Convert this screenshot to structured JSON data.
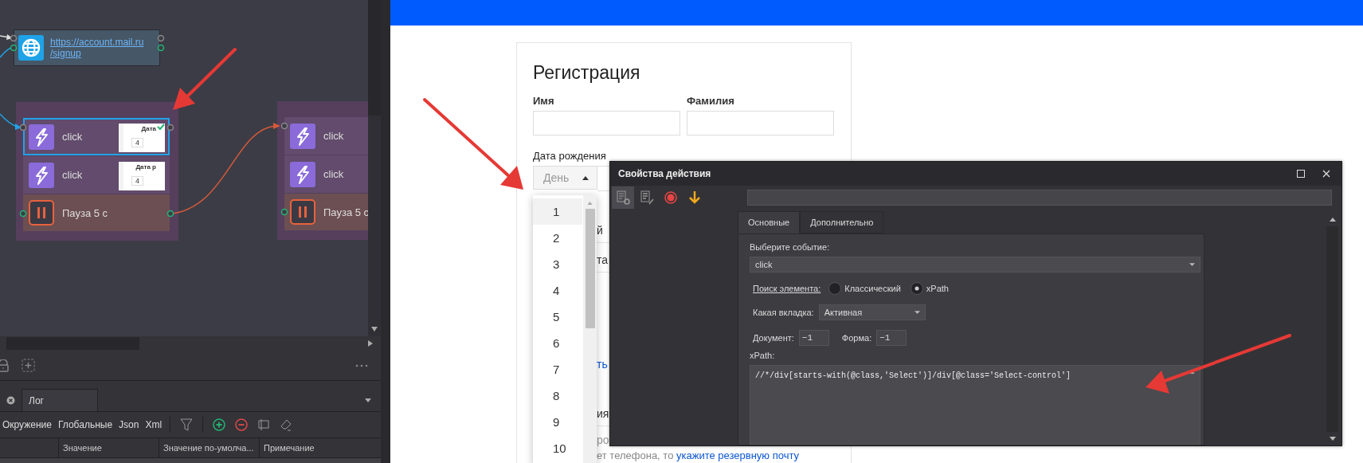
{
  "canvas": {
    "url_node": {
      "url_lines": [
        "https://account.mail.ru",
        "/signup"
      ]
    },
    "groups": [
      {
        "rows": [
          {
            "kind": "action",
            "label": "click",
            "selected": true,
            "thumbnail": {
              "label": "Дата",
              "value": "4",
              "checked": true
            }
          },
          {
            "kind": "action",
            "label": "click",
            "selected": false,
            "thumbnail": {
              "label": "Дата р",
              "value": "4",
              "checked": false
            }
          },
          {
            "kind": "pause",
            "label": "Пауза 5 с",
            "selected": false
          }
        ]
      },
      {
        "rows": [
          {
            "kind": "action",
            "label": "click",
            "selected": false
          },
          {
            "kind": "action",
            "label": "click",
            "selected": false
          },
          {
            "kind": "pause",
            "label": "Пауза 5 с",
            "selected": false
          }
        ]
      }
    ]
  },
  "bottom_panel": {
    "tabs": [
      {
        "label": "Лог",
        "selected": true
      }
    ],
    "toolbar": [
      "Окружение",
      "Глобальные",
      "Json",
      "Xml"
    ],
    "columns": [
      "Значение",
      "Значение по-умолча...",
      "Примечание"
    ]
  },
  "page": {
    "title": "Регистрация",
    "fields": [
      {
        "label": "Имя"
      },
      {
        "label": "Фамилия"
      }
    ],
    "birth_date": {
      "label": "Дата рождения",
      "day_select": {
        "placeholder": "День",
        "expanded": true
      }
    },
    "day_options": [
      {
        "label": "1",
        "selected": true
      },
      {
        "label": "2",
        "selected": false
      },
      {
        "label": "3",
        "selected": false
      },
      {
        "label": "4",
        "selected": false
      },
      {
        "label": "5",
        "selected": false
      },
      {
        "label": "6",
        "selected": false
      },
      {
        "label": "7",
        "selected": false
      },
      {
        "label": "8",
        "selected": false
      },
      {
        "label": "9",
        "selected": false
      },
      {
        "label": "10",
        "selected": false
      }
    ],
    "fragments": [
      {
        "text": "й",
        "kind": "text"
      },
      {
        "text": "та",
        "kind": "text"
      },
      {
        "text": "ть",
        "kind": "link"
      },
      {
        "text": "ия",
        "kind": "text"
      },
      {
        "text": "ро",
        "kind": "text"
      }
    ],
    "note": {
      "text": "ет телефона, то",
      "link": "укажите резервную почту"
    }
  },
  "dialog": {
    "title": "Свойства действия",
    "tabs": [
      {
        "label": "Основные",
        "selected": true
      },
      {
        "label": "Дополнительно",
        "selected": false
      }
    ],
    "event_label": "Выберите событие:",
    "event_value": "click",
    "search_label": "Поиск элемента:",
    "search_modes": [
      {
        "label": "Классический",
        "selected": false
      },
      {
        "label": "xPath",
        "selected": true
      }
    ],
    "tab_label": "Какая вкладка:",
    "tab_value": "Активная",
    "document_label": "Документ:",
    "document_value": "−1",
    "form_label": "Форма:",
    "form_value": "−1",
    "xpath_label": "xPath:",
    "xpath_value": "//*/div[starts-with(@class,'Select')]/div[@class='Select-control']"
  }
}
